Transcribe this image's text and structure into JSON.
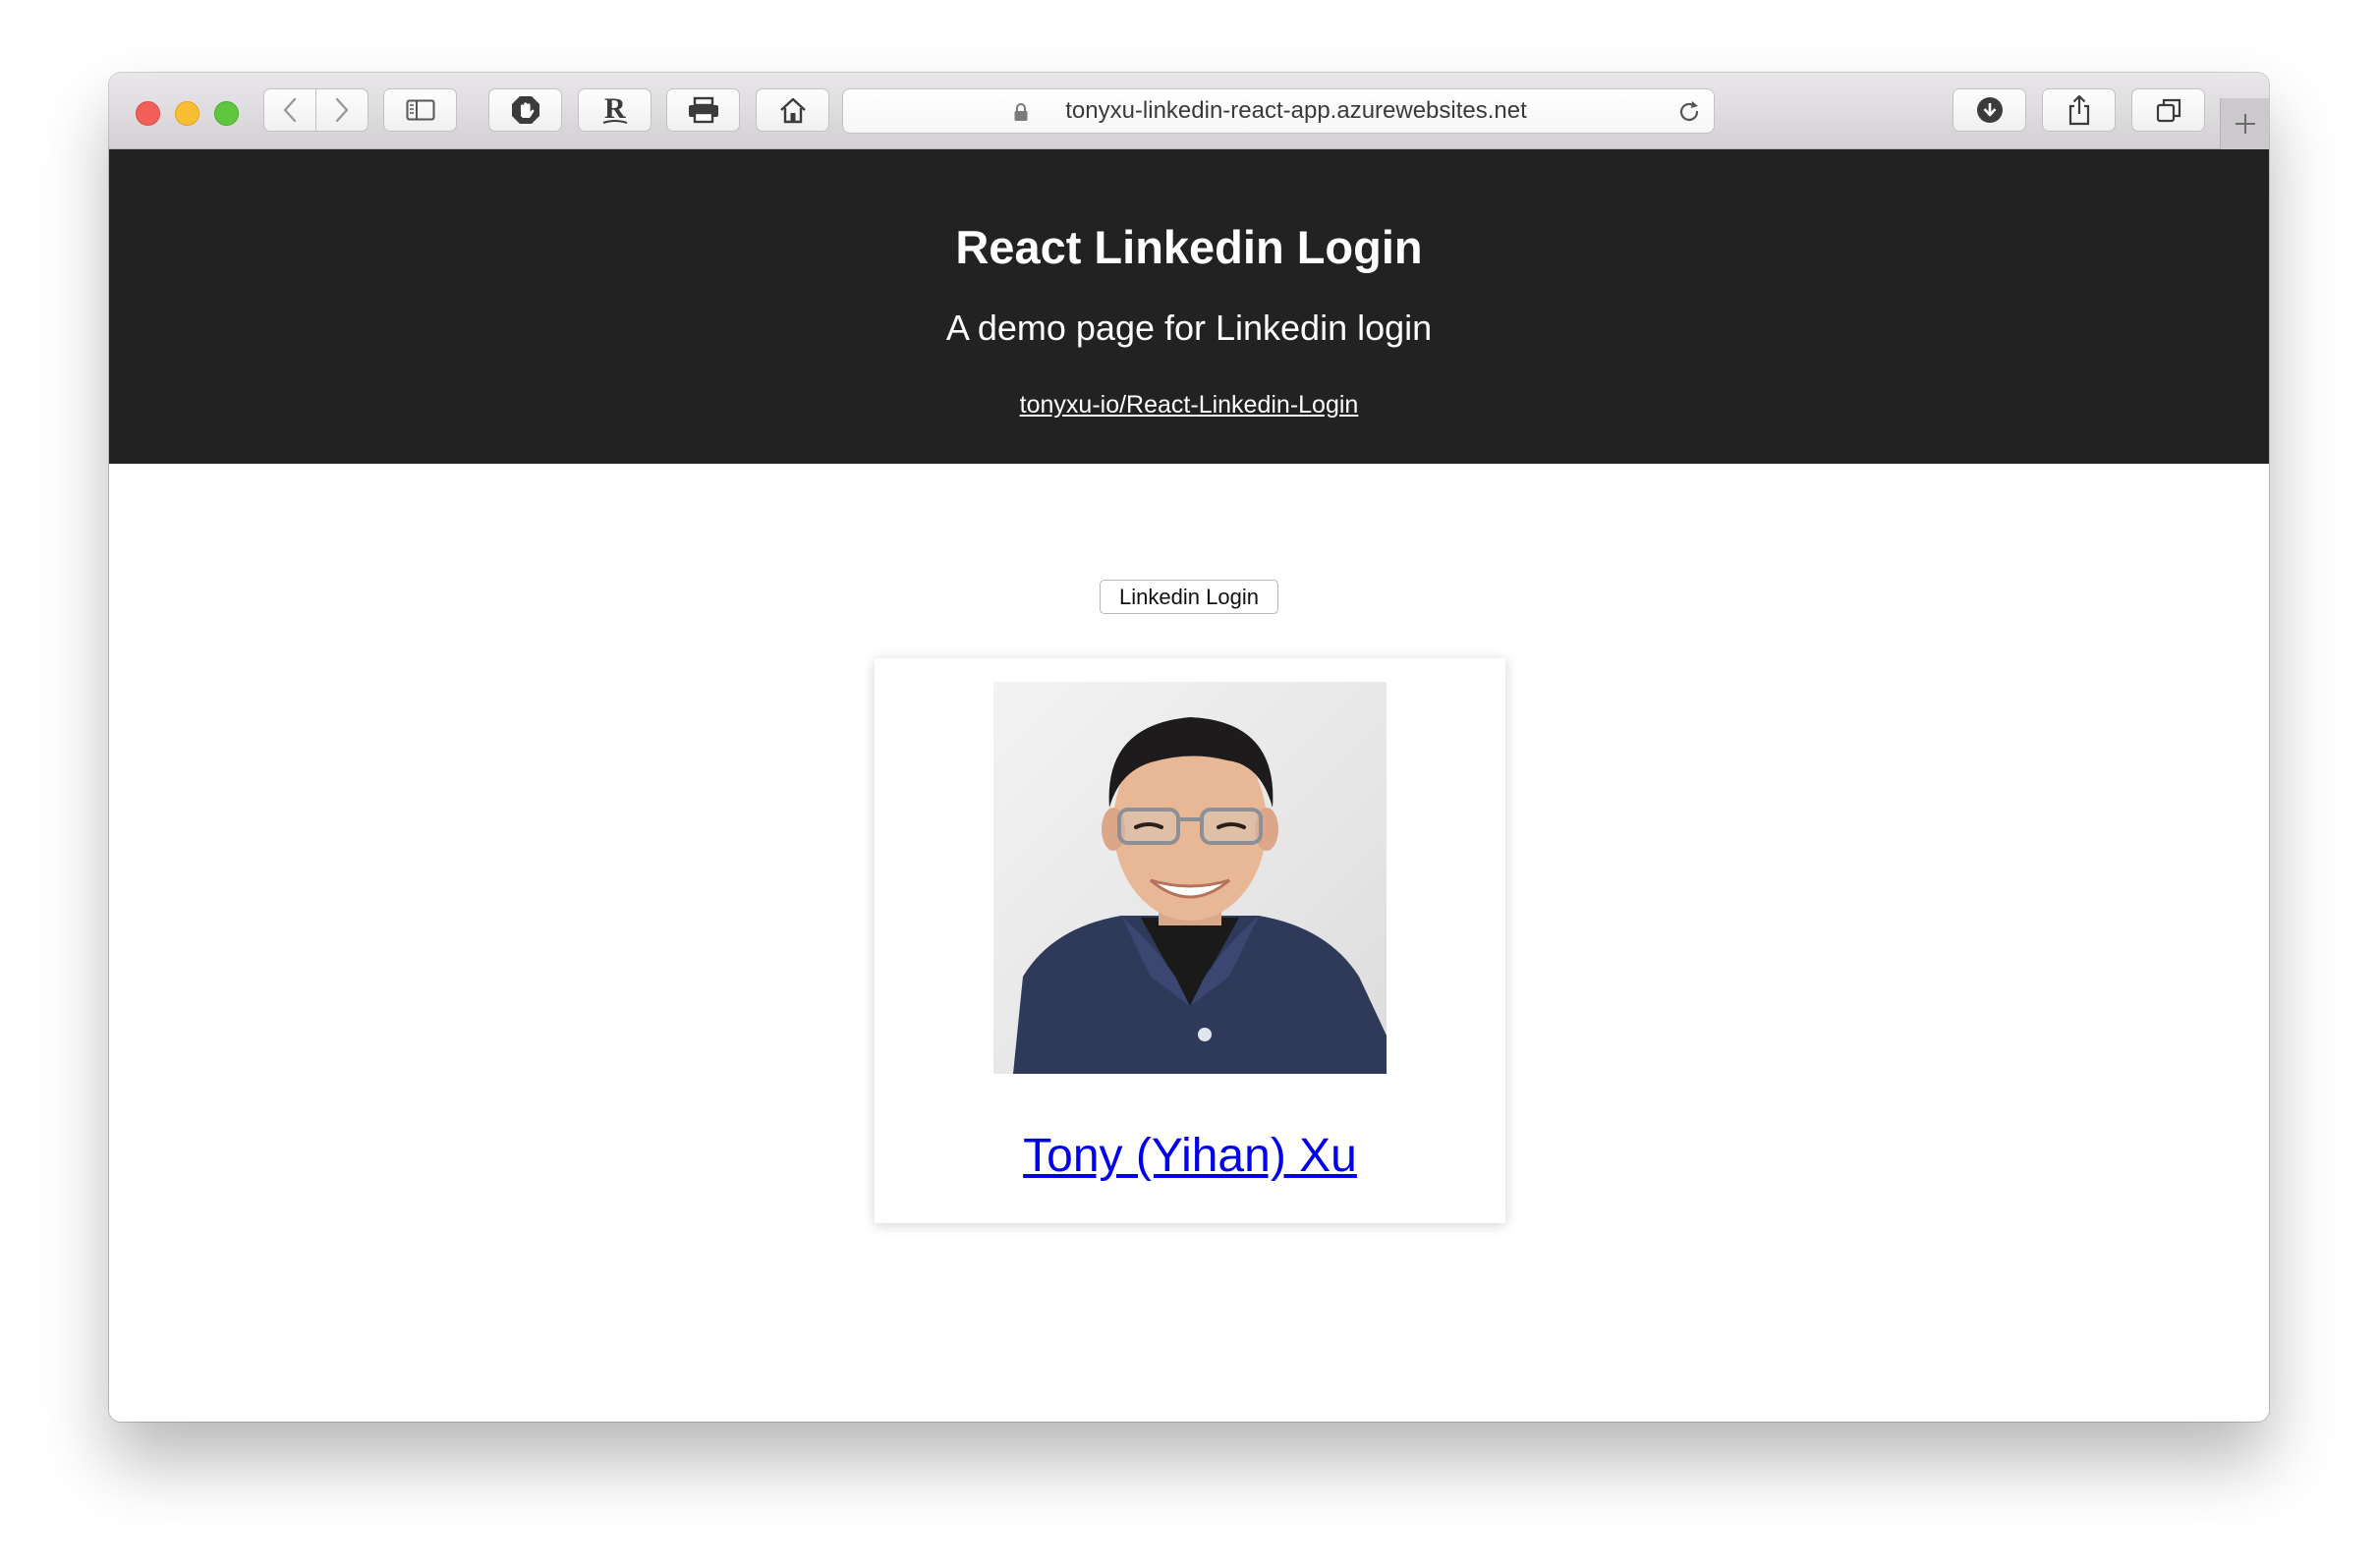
{
  "browser": {
    "url": "tonyxu-linkedin-react-app.azurewebsites.net",
    "icons": {
      "back": "chevron-left-icon",
      "forward": "chevron-right-icon",
      "sidebar": "sidebar-icon",
      "adblock": "hand-stop-icon",
      "rakuten": "rakuten-r-icon",
      "print": "printer-icon",
      "home": "home-icon",
      "lock": "lock-icon",
      "reload": "reload-icon",
      "downloads": "download-icon",
      "share": "share-icon",
      "tabs": "tabs-icon",
      "new_tab": "plus-icon"
    }
  },
  "header": {
    "title": "React Linkedin Login",
    "subtitle": "A demo page for Linkedin login",
    "repo_link": "tonyxu-io/React-Linkedin-Login",
    "background": "#222222"
  },
  "main": {
    "login_button": "Linkedin Login",
    "profile": {
      "name": "Tony (Yihan) Xu",
      "link_color": "#0000ee"
    }
  }
}
